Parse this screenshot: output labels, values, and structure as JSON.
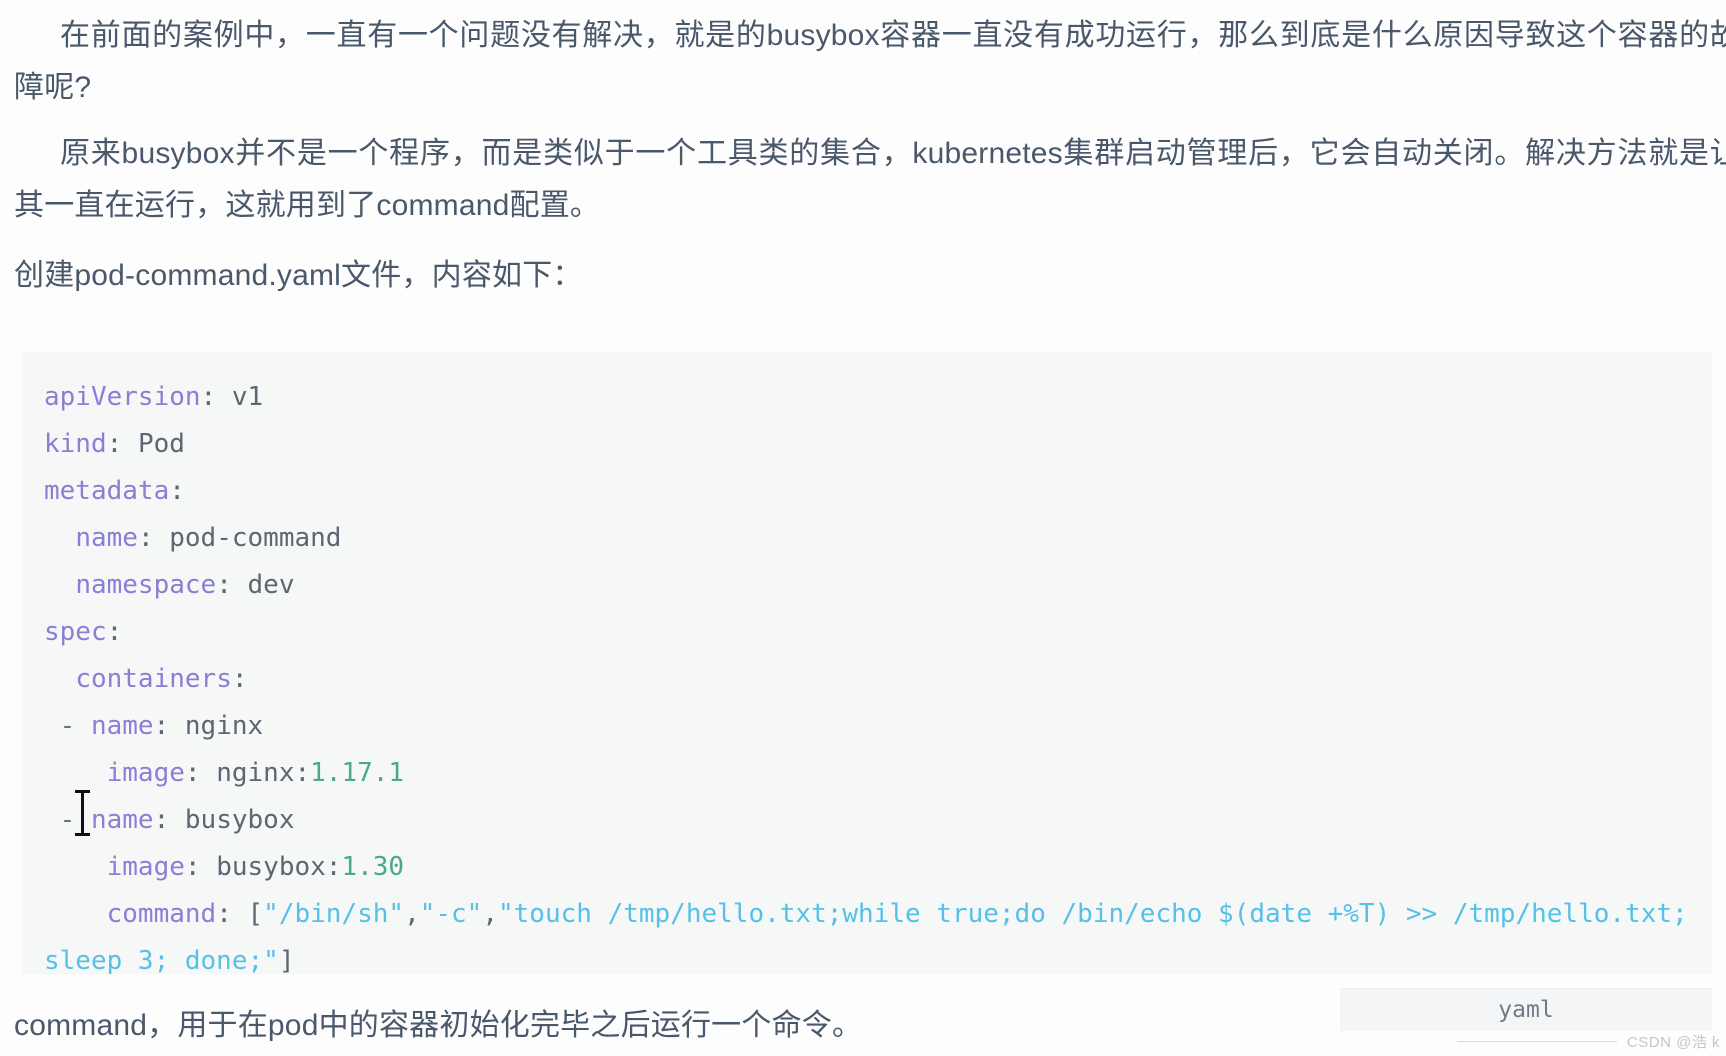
{
  "document": {
    "paragraphs": [
      "在前面的案例中，一直有一个问题没有解决，就是的busybox容器一直没有成功运行，那么到底是什么原因导致这个容器的故障呢?",
      "原来busybox并不是一个程序，而是类似于一个工具类的集合，kubernetes集群启动管理后，它会自动关闭。解决方法就是让其一直在运行，这就用到了command配置。",
      "创建pod-command.yaml文件，内容如下：",
      "command，用于在pod中的容器初始化完毕之后运行一个命令。"
    ]
  },
  "code_block": {
    "language_label": "yaml",
    "background": "#f6f8f7",
    "colors": {
      "key": "#8a7fd4",
      "value": "#5d6673",
      "number": "#4aa989",
      "string": "#56c0e8"
    },
    "lines": [
      {
        "indent": 0,
        "key": "apiVersion",
        "sep": ": ",
        "value": "v1",
        "value_type": "plain"
      },
      {
        "indent": 0,
        "key": "kind",
        "sep": ": ",
        "value": "Pod",
        "value_type": "plain"
      },
      {
        "indent": 0,
        "key": "metadata",
        "sep": ":",
        "value": "",
        "value_type": "plain"
      },
      {
        "indent": 1,
        "key": "name",
        "sep": ": ",
        "value": "pod-command",
        "value_type": "plain"
      },
      {
        "indent": 1,
        "key": "namespace",
        "sep": ": ",
        "value": "dev",
        "value_type": "plain"
      },
      {
        "indent": 0,
        "key": "spec",
        "sep": ":",
        "value": "",
        "value_type": "plain"
      },
      {
        "indent": 1,
        "key": "containers",
        "sep": ":",
        "value": "",
        "value_type": "plain"
      },
      {
        "indent": 1,
        "dash": "- ",
        "key": "name",
        "sep": ": ",
        "value": "nginx",
        "value_type": "plain"
      },
      {
        "indent": 2,
        "key": "image",
        "sep": ": ",
        "value": "nginx:1.17.1",
        "value_type": "image",
        "image_name": "nginx:",
        "image_tag": "1.17.1"
      },
      {
        "indent": 1,
        "dash": "- ",
        "key": "name",
        "sep": ": ",
        "value": "busybox",
        "value_type": "plain"
      },
      {
        "indent": 2,
        "key": "image",
        "sep": ": ",
        "value": "busybox:1.30",
        "value_type": "image",
        "image_name": "busybox:",
        "image_tag": "1.30"
      },
      {
        "indent": 2,
        "key": "command",
        "sep": ": ",
        "value_type": "command",
        "array_open": "[",
        "array_items": [
          "\"/bin/sh\"",
          "\"-c\"",
          "\"touch /tmp/hello.txt;while true;do /bin/echo $(date +%T) >> /tmp/hello.txt; sleep 3; done;\""
        ],
        "array_close": "]"
      }
    ],
    "raw_text": "apiVersion: v1\nkind: Pod\nmetadata:\n  name: pod-command\n  namespace: dev\nspec:\n  containers:\n  - name: nginx\n    image: nginx:1.17.1\n  - name: busybox\n    image: busybox:1.30\n    command: [\"/bin/sh\",\"-c\",\"touch /tmp/hello.txt;while true;do /bin/echo $(date +%T) >> /tmp/hello.txt; sleep 3; done;\"]"
  },
  "watermark": {
    "text": "CSDN @浩 k"
  }
}
